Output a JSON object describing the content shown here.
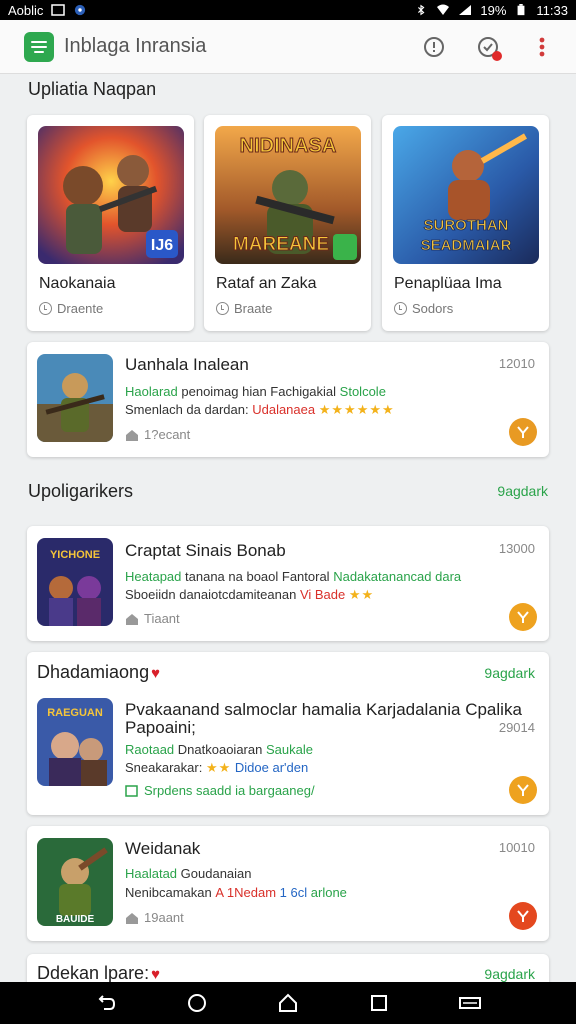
{
  "status_bar": {
    "carrier": "Aoblic",
    "battery": "19%",
    "time": "11:33"
  },
  "app": {
    "title": "Inblaga Inransia"
  },
  "section_top": {
    "title": "Upliatia Naqpan"
  },
  "tiles": [
    {
      "name": "Naokanaia",
      "sub": "Draente",
      "art_text": "IJ6"
    },
    {
      "name": "Rataf an Zaka",
      "sub": "Braate",
      "art_text_top": "NIDINASA",
      "art_text_bottom": "MAREANE"
    },
    {
      "name": "Penaplüaa Ima",
      "sub": "Sodors",
      "art_text": "SUROTHAN SEADMAIAR"
    }
  ],
  "featured": {
    "title": "Uanhala Inalean",
    "number": "12010",
    "line1_green": "Haolarad",
    "line1_dark": "penoimag hian Fachigakial",
    "line1_green2": "Stolcole",
    "line2_dark": "Smenlach da dardan:",
    "line2_red": "Udalanaea",
    "stars": "★★★★★★",
    "meta": "1?ecant",
    "fab_color": "#e89a23"
  },
  "section_mid": {
    "title": "Upoligarikers",
    "link": "9agdark"
  },
  "list": [
    {
      "title": "Craptat Sinais Bonab",
      "number": "13000",
      "line1_green": "Heatapad",
      "line1_dark": "tanana na boaol Fantoral",
      "line1_green2": "Nadakatanancad dara",
      "line2_dark": "Sboeiidn danaiotcdamiteanan",
      "line2_red": "Vi Bade",
      "stars": "★★",
      "meta": "Tiaant",
      "thumb_text": "YICHONE",
      "fab_color": "#eea21f"
    }
  ],
  "section_three": {
    "title": "Dhadamiaong",
    "link": "9agdark"
  },
  "card_three": {
    "title": "Pvakaanand salmoclar hamalia Karjadalania Cpalika",
    "title2": "Papoaini;",
    "number": "29014",
    "line1_green": "Raotaad",
    "line1_dark": "Dnatkoaoiaran",
    "line1_green2": "Saukale",
    "line2_dark": "Sneakarakar:",
    "line2_stars": "★★",
    "line2_tail": "Didoe ar'den",
    "meta": "Srpdens saadd ia bargaaneg/",
    "thumb_text": "RAEGUAN",
    "fab_color": "#eea21f"
  },
  "card_four": {
    "title": "Weidanak",
    "number": "10010",
    "line1_green": "Haalatad",
    "line1_dark": "Goudanaian",
    "line2_dark": "Nenibcamakan",
    "line2_red": "A 1Nedam",
    "line2_blue": "1 6cl",
    "line2_tail": "arlone",
    "meta": "19aant",
    "thumb_text": "BAUIDE",
    "fab_color": "#e4481f"
  },
  "section_four": {
    "title": "Ddekan lpare:",
    "link": "9agdark"
  }
}
